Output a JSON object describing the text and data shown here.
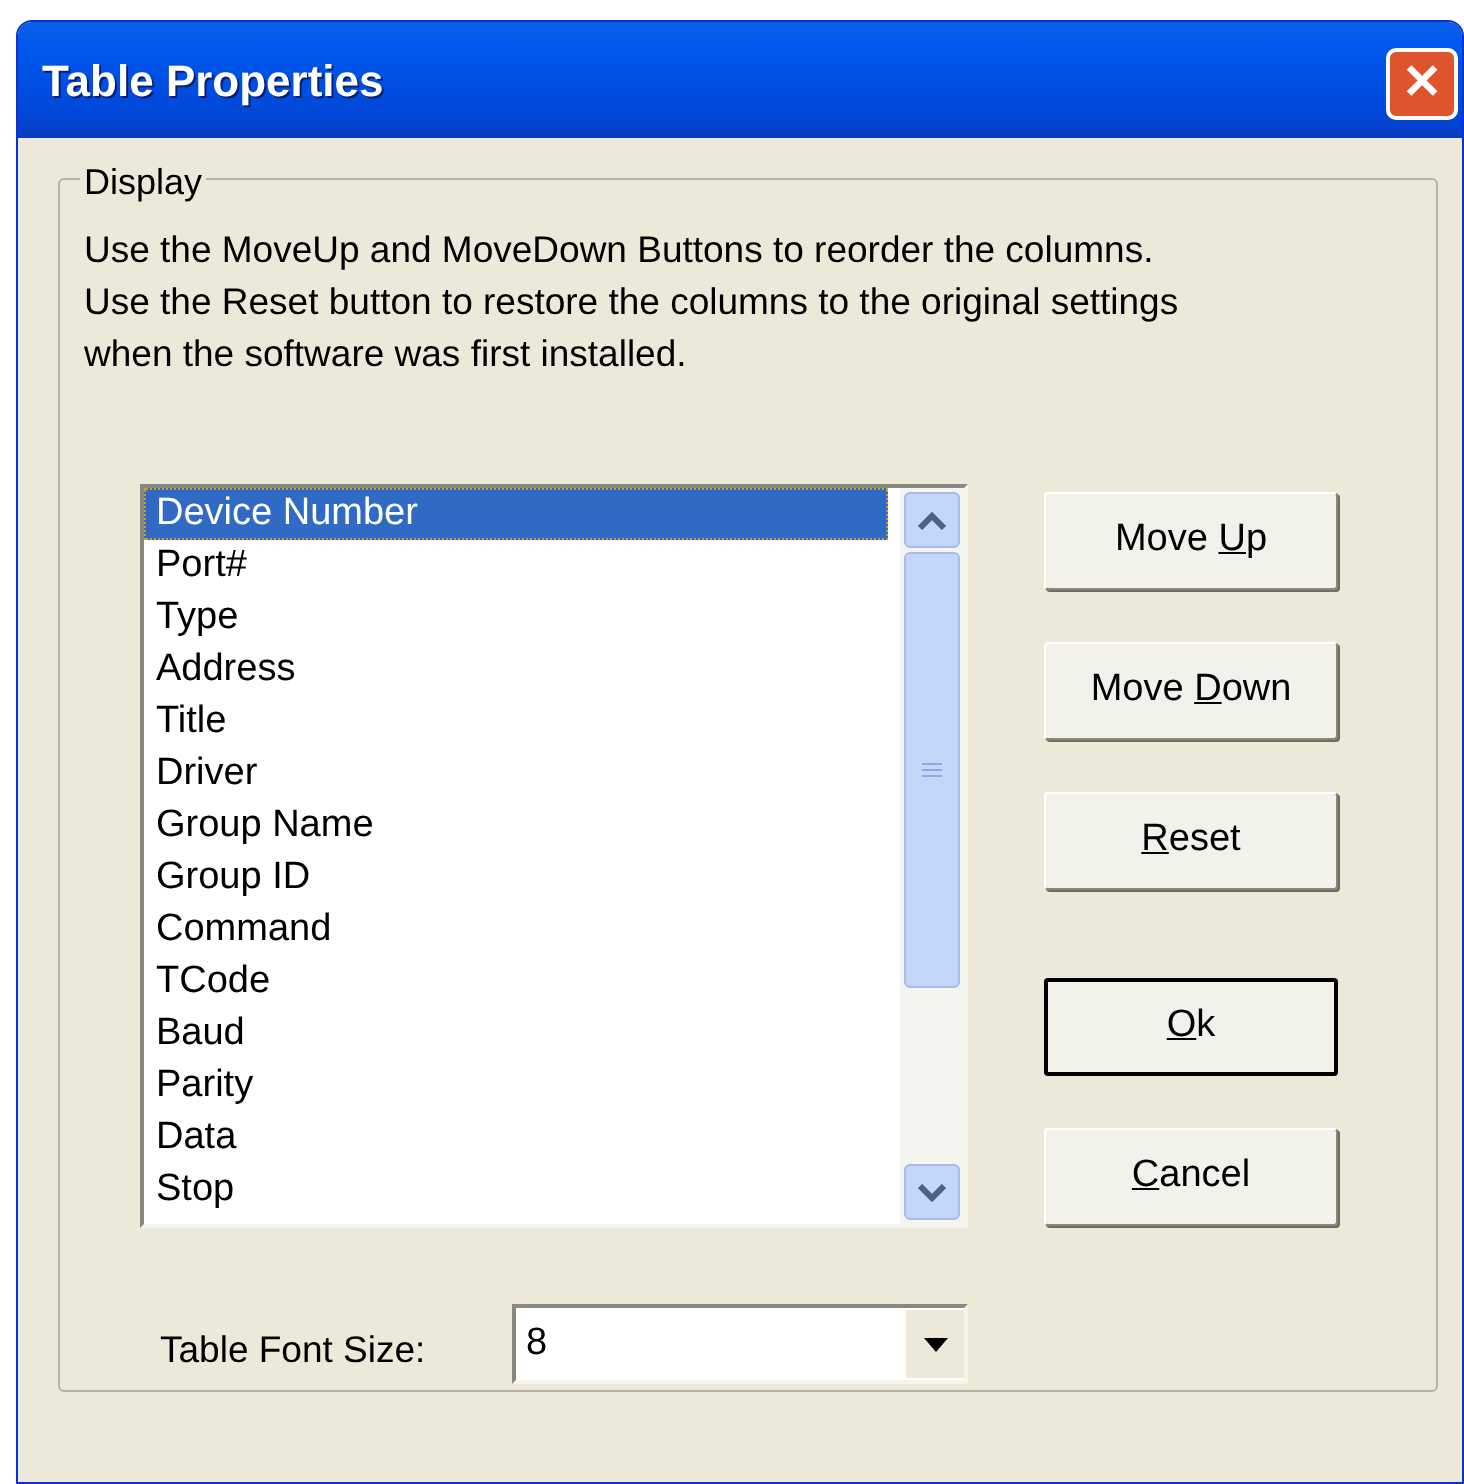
{
  "window": {
    "title": "Table Properties",
    "close": "✕"
  },
  "group": {
    "legend": "Display",
    "description": [
      "Use the MoveUp and MoveDown Buttons to reorder the columns.",
      "Use the Reset button to restore the columns to the original settings",
      "when the software was first installed."
    ]
  },
  "columns": [
    {
      "label": "Device Number",
      "selected": true
    },
    {
      "label": "Port#",
      "selected": false
    },
    {
      "label": "Type",
      "selected": false
    },
    {
      "label": "Address",
      "selected": false
    },
    {
      "label": "Title",
      "selected": false
    },
    {
      "label": "Driver",
      "selected": false
    },
    {
      "label": "Group Name",
      "selected": false
    },
    {
      "label": "Group ID",
      "selected": false
    },
    {
      "label": "Command",
      "selected": false
    },
    {
      "label": "TCode",
      "selected": false
    },
    {
      "label": "Baud",
      "selected": false
    },
    {
      "label": "Parity",
      "selected": false
    },
    {
      "label": "Data",
      "selected": false
    },
    {
      "label": "Stop",
      "selected": false
    }
  ],
  "order_buttons": [
    {
      "before": "Move ",
      "key": "U",
      "after": "p",
      "default": false
    },
    {
      "before": "Move ",
      "key": "D",
      "after": "own",
      "default": false
    },
    {
      "key": "R",
      "after": "eset",
      "default": false
    }
  ],
  "dialog_buttons": [
    {
      "key": "O",
      "after": "k",
      "default": true
    },
    {
      "key": "C",
      "after": "ancel",
      "default": false
    }
  ],
  "font_size": {
    "label": "Table Font Size:",
    "value": "8"
  }
}
